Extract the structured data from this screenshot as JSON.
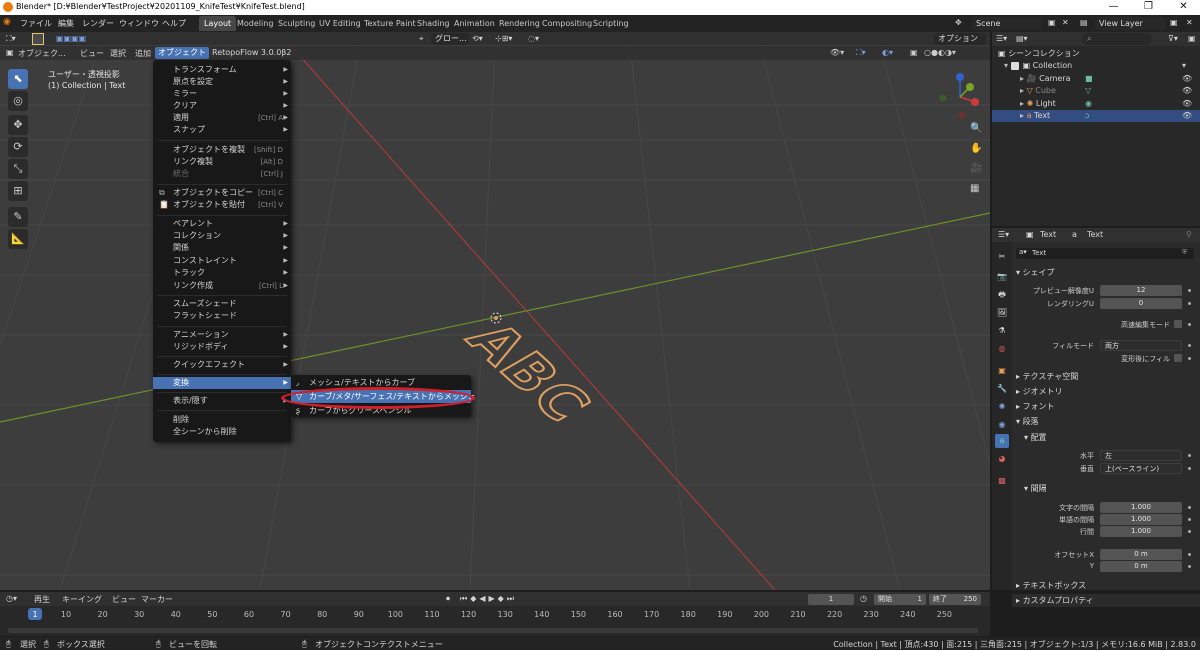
{
  "window": {
    "title": "Blender* [D:¥Blender¥TestProject¥20201109_KnifeTest¥KnifeTest.blend]",
    "min": "—",
    "max": "❐",
    "close": "✕"
  },
  "top_menu": [
    "ファイル",
    "編集",
    "レンダー",
    "ウィンドウ",
    "ヘルプ"
  ],
  "workspaces": [
    "Layout",
    "Modeling",
    "Sculpting",
    "UV Editing",
    "Texture Paint",
    "Shading",
    "Animation",
    "Rendering",
    "Compositing",
    "Scripting"
  ],
  "active_workspace": "Layout",
  "scene": "Scene",
  "view_layer": "View Layer",
  "viewport_header": {
    "mode": "オブジェク...",
    "menus": [
      "ビュー",
      "選択",
      "追加",
      "オブジェクト",
      "RetopoFlow 3.0.0β2"
    ],
    "transform_orientation": "グロー...",
    "options": "オプション"
  },
  "viewport_overlay": {
    "view_name": "ユーザー・透視投影",
    "collection_info": "(1) Collection | Text",
    "text_object": "ABC"
  },
  "object_menu": [
    {
      "label": "トランスフォーム",
      "submenu": true
    },
    {
      "label": "原点を設定",
      "submenu": true
    },
    {
      "label": "ミラー",
      "submenu": true
    },
    {
      "label": "クリア",
      "submenu": true
    },
    {
      "label": "適用",
      "shortcut": "[Ctrl] A",
      "submenu": true
    },
    {
      "label": "スナップ",
      "submenu": true
    },
    {
      "label": "オブジェクトを複製",
      "shortcut": "[Shift] D"
    },
    {
      "label": "リンク複製",
      "shortcut": "[Alt] D"
    },
    {
      "label": "統合",
      "shortcut": "[Ctrl] J",
      "disabled": true
    },
    {
      "label": "オブジェクトをコピー",
      "shortcut": "[Ctrl] C"
    },
    {
      "label": "オブジェクトを貼付",
      "shortcut": "[Ctrl] V"
    },
    {
      "label": "ペアレント",
      "submenu": true
    },
    {
      "label": "コレクション",
      "submenu": true
    },
    {
      "label": "関係",
      "submenu": true
    },
    {
      "label": "コンストレイント",
      "submenu": true
    },
    {
      "label": "トラック",
      "submenu": true
    },
    {
      "label": "リンク作成",
      "shortcut": "[Ctrl] L",
      "submenu": true
    },
    {
      "label": "スムーズシェード"
    },
    {
      "label": "フラットシェード"
    },
    {
      "label": "アニメーション",
      "submenu": true
    },
    {
      "label": "リジッドボディ",
      "submenu": true
    },
    {
      "label": "クイックエフェクト",
      "submenu": true
    },
    {
      "label": "変換",
      "submenu": true,
      "highlighted": true
    },
    {
      "label": "表示/隠す",
      "submenu": true
    },
    {
      "label": "削除"
    },
    {
      "label": "全シーンから削除"
    }
  ],
  "convert_submenu": [
    {
      "label": "メッシュ/テキストからカーブ"
    },
    {
      "label": "カーブ/メタ/サーフェス/テキストからメッシュ",
      "highlighted": true
    },
    {
      "label": "カーブからグリースペンシル"
    }
  ],
  "outliner": {
    "title": "シーンコレクション",
    "items": [
      {
        "label": "Collection",
        "depth": 0
      },
      {
        "label": "Camera",
        "depth": 1
      },
      {
        "label": "Cube",
        "depth": 1
      },
      {
        "label": "Light",
        "depth": 1
      },
      {
        "label": "Text",
        "depth": 1,
        "selected": true
      }
    ]
  },
  "properties": {
    "header_object": "Text",
    "header_data": "Text",
    "datablock": "Text",
    "sections": {
      "shape": "シェイプ",
      "texture_space": "テクスチャ空間",
      "geometry": "ジオメトリ",
      "font": "フォント",
      "paragraph": "段落",
      "alignment": "配置",
      "spacing": "間隔",
      "text_boxes": "テキストボックス",
      "custom_props": "カスタムプロパティ"
    },
    "fields": {
      "preview_res_label": "プレビュー解像度U",
      "preview_res": "12",
      "render_res_label": "レンダリングU",
      "render_res": "0",
      "fast_edit_label": "高速編集モード",
      "fill_mode_label": "フィルモード",
      "fill_mode": "両方",
      "fill_deform_label": "変形後にフィル",
      "h_align_label": "水平",
      "h_align": "左",
      "v_align_label": "垂直",
      "v_align": "上(ベースライン)",
      "char_spacing_label": "文字の間隔",
      "char_spacing": "1.000",
      "word_spacing_label": "単語の間隔",
      "word_spacing": "1.000",
      "line_spacing_label": "行間",
      "line_spacing": "1.000",
      "offset_x_label": "オフセットX",
      "offset_x": "0 m",
      "offset_y_label": "Y",
      "offset_y": "0 m"
    }
  },
  "timeline": {
    "menus": [
      "再生",
      "キーイング",
      "ビュー",
      "マーカー"
    ],
    "current_frame": "1",
    "start_label": "開始",
    "start": "1",
    "end_label": "終了",
    "end": "250",
    "ticks": [
      "1",
      "10",
      "20",
      "30",
      "40",
      "50",
      "60",
      "70",
      "80",
      "90",
      "100",
      "110",
      "120",
      "130",
      "140",
      "150",
      "160",
      "170",
      "180",
      "190",
      "200",
      "210",
      "220",
      "230",
      "240",
      "250"
    ]
  },
  "status_bar": {
    "select": "選択",
    "box_select": "ボックス選択",
    "rotate_view": "ビューを回転",
    "context_menu": "オブジェクトコンテクストメニュー",
    "stats": "Collection | Text | 頂点:430 | 面:215 | 三角面:215 | オブジェクト:1/3 | メモリ:16.6 MiB | 2.83.0"
  },
  "colors": {
    "accent": "#4772b3",
    "text_object": "#e0a060",
    "x_axis": "#a83a3a",
    "y_axis": "#6f8f2a",
    "annotation": "#d21f2a"
  }
}
